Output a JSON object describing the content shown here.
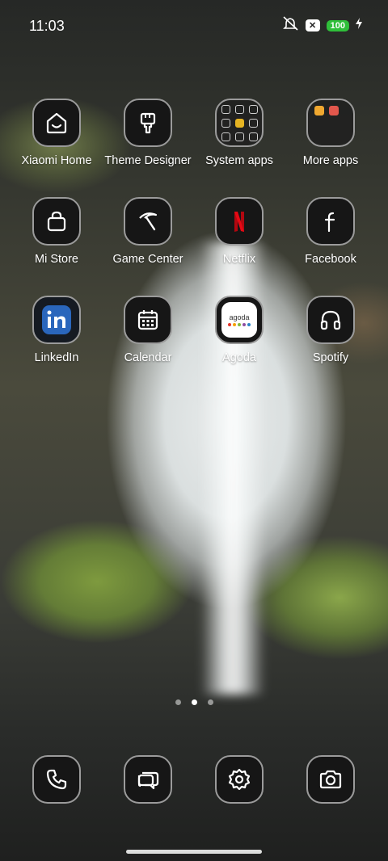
{
  "status_bar": {
    "time": "11:03",
    "battery": "100",
    "icons": [
      "mute-icon",
      "x-icon",
      "battery-icon",
      "charging-icon"
    ]
  },
  "apps": [
    {
      "label": "Xiaomi Home",
      "icon": "xiaomi-home-icon"
    },
    {
      "label": "Theme Designer",
      "icon": "paintbrush-icon"
    },
    {
      "label": "System apps",
      "icon": "folder-icon"
    },
    {
      "label": "More apps",
      "icon": "folder-icon"
    },
    {
      "label": "Mi Store",
      "icon": "shopping-bag-icon"
    },
    {
      "label": "Game Center",
      "icon": "pickaxe-icon"
    },
    {
      "label": "Netflix",
      "icon": "netflix-icon"
    },
    {
      "label": "Facebook",
      "icon": "facebook-icon"
    },
    {
      "label": "LinkedIn",
      "icon": "linkedin-icon"
    },
    {
      "label": "Calendar",
      "icon": "calendar-icon"
    },
    {
      "label": "Agoda",
      "icon": "agoda-icon"
    },
    {
      "label": "Spotify",
      "icon": "headphones-icon"
    }
  ],
  "agoda_logo_text": "agoda",
  "page_indicator": {
    "total": 3,
    "current": 2
  },
  "dock": [
    {
      "name": "phone",
      "icon": "phone-icon"
    },
    {
      "name": "messages",
      "icon": "chat-icon"
    },
    {
      "name": "settings",
      "icon": "gear-icon"
    },
    {
      "name": "camera",
      "icon": "camera-icon"
    }
  ],
  "colors": {
    "tile_bg": "#161616",
    "tile_border": "#9b9b9b",
    "battery": "#2fbf3a",
    "netflix": "#e50914",
    "linkedin": "#2a66bc"
  }
}
